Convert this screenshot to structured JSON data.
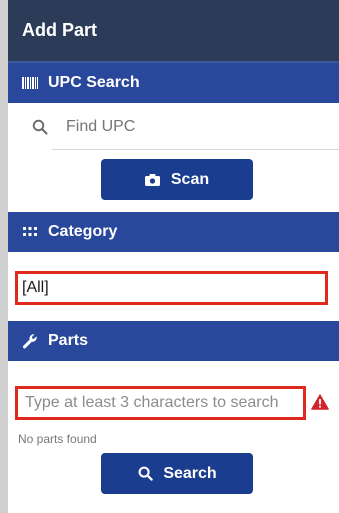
{
  "header": {
    "title": "Add Part"
  },
  "upc_section": {
    "label": "UPC Search",
    "icon": "barcode-icon",
    "search_placeholder": "Find UPC",
    "scan_label": "Scan",
    "scan_icon": "camera-icon"
  },
  "category_section": {
    "label": "Category",
    "icon": "grid-icon",
    "selected": "[All]"
  },
  "parts_section": {
    "label": "Parts",
    "icon": "wrench-icon",
    "search_placeholder": "Type at least 3 characters to search",
    "status": "No parts found",
    "search_label": "Search",
    "search_icon": "search-icon",
    "warning_icon": "warning-icon"
  },
  "colors": {
    "title_bar": "#2c3b58",
    "section_header": "#29479b",
    "button": "#1b3d8f",
    "highlight_border": "#e0281c",
    "warning": "#d2232a"
  }
}
